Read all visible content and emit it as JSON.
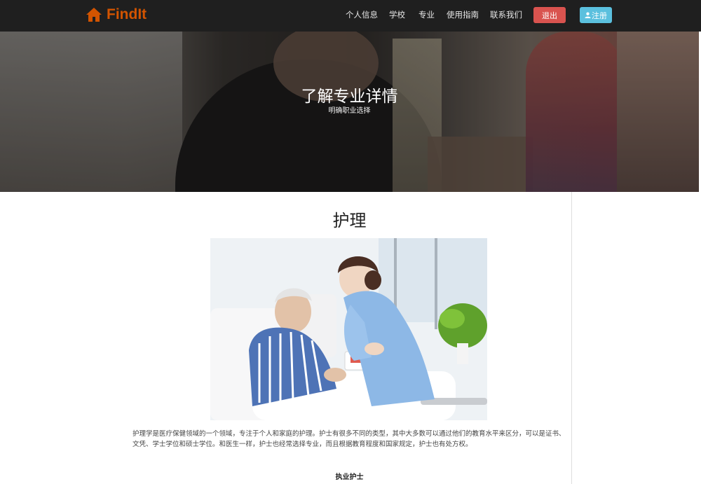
{
  "nav": {
    "brand": "FindIt",
    "links": [
      "个人信息",
      "学校",
      "专业",
      "使用指南",
      "联系我们"
    ],
    "logout": "退出",
    "register": "注册",
    "colors": {
      "bar": "#1f1f1f",
      "brand": "#d35400",
      "logout": "#d9534f",
      "register": "#5bc0de"
    }
  },
  "hero": {
    "title": "了解专业详情",
    "subtitle": "明确职业选择"
  },
  "major": {
    "title": "护理",
    "description": "护理学是医疗保健领域的一个领域，专注于个人和家庭的护理。护士有很多不同的类型，其中大多数可以通过他们的教育水平来区分，可以是证书、文凭、学士学位和硕士学位。和医生一样，护士也经常选择专业，而且根据教育程度和国家规定，护士也有处方权。",
    "subheading": "执业护士"
  }
}
